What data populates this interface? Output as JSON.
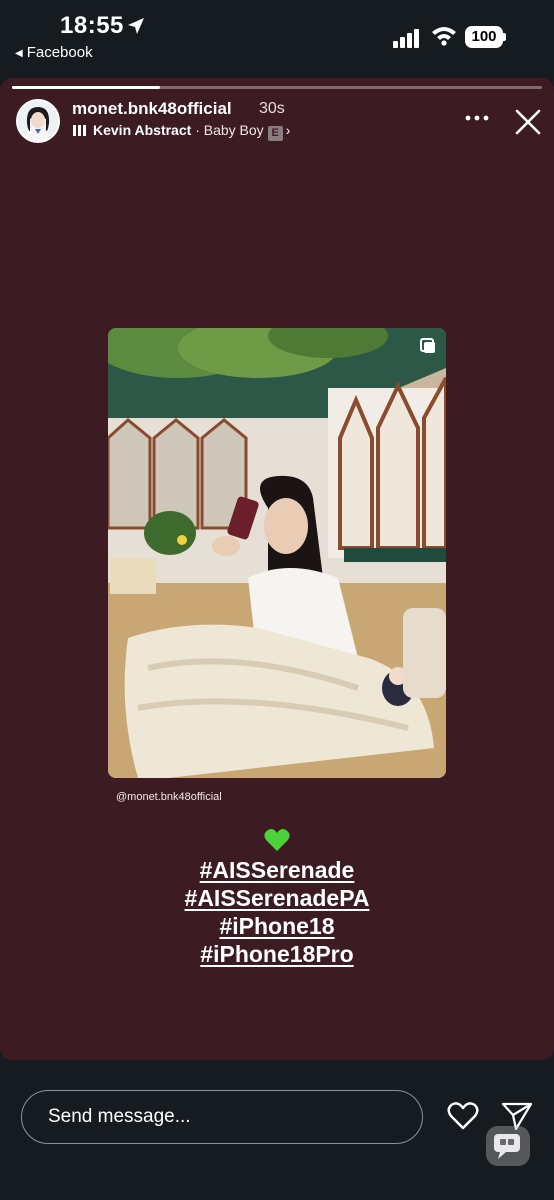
{
  "status_bar": {
    "time": "18:55",
    "back_app": "Facebook",
    "battery": "100"
  },
  "story": {
    "progress": 0.28,
    "username": "monet.bnk48official",
    "age": "30s",
    "music": {
      "artist": "Kevin Abstract",
      "separator": "·",
      "song": "Baby Boy",
      "explicit": "E"
    },
    "photo_credit": "@monet.bnk48official",
    "hashtags": [
      "#AISSerenade",
      "#AISSerenadePA",
      "#iPhone18",
      "#iPhone18Pro"
    ],
    "background_color": "#3d1b23"
  },
  "footer": {
    "message_placeholder": "Send message..."
  }
}
